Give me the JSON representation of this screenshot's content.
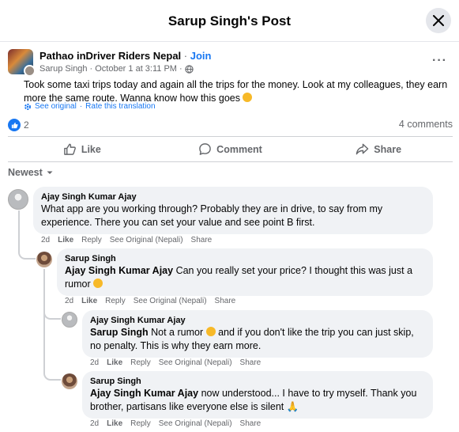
{
  "header": {
    "title": "Sarup Singh's Post"
  },
  "post": {
    "group_name": "Pathao inDriver Riders Nepal",
    "separator": "·",
    "join_label": "Join",
    "author": "Sarup Singh",
    "date": "October 1 at 3:11 PM",
    "body": "Took some taxi trips today and again all the trips for the money. Look at my colleagues, they earn more the same route. Wanna know how this goes",
    "see_original": "See original",
    "rate_translation": "Rate this translation",
    "reaction_count": "2",
    "comments_count": "4 comments"
  },
  "actions": {
    "like": "Like",
    "comment": "Comment",
    "share": "Share"
  },
  "sort": {
    "label": "Newest"
  },
  "comment_actions": {
    "like": "Like",
    "reply": "Reply",
    "see_original": "See Original (Nepali)",
    "share": "Share"
  },
  "comments": [
    {
      "author": "Ajay Singh Kumar Ajay",
      "mention": "",
      "text": "What app are you working through? Probably they are in drive, to say from my experience. There you can set your value and see point B first.",
      "time": "2d"
    },
    {
      "author": "Sarup Singh",
      "mention": "Ajay Singh Kumar Ajay",
      "text": "Can you really set your price? I thought this was just a rumor",
      "time": "2d"
    },
    {
      "author": "Ajay Singh Kumar Ajay",
      "mention": "Sarup Singh",
      "text_a": "Not a rumor",
      "text_b": "and if you don't like the trip you can just skip, no penalty. This is why they earn more.",
      "time": "2d"
    },
    {
      "author": "Sarup Singh",
      "mention": "Ajay Singh Kumar Ajay",
      "text": "now understood... I have to try myself. Thank you brother, partisans like everyone else is silent",
      "time": "2d"
    }
  ],
  "colors": {
    "accent": "#1877f2",
    "muted": "#65676b",
    "bubble": "#f0f2f5"
  },
  "icons": [
    "close-icon",
    "more-icon",
    "globe-icon",
    "gear-icon",
    "like-icon",
    "comment-icon",
    "share-icon",
    "chevron-down-icon"
  ]
}
